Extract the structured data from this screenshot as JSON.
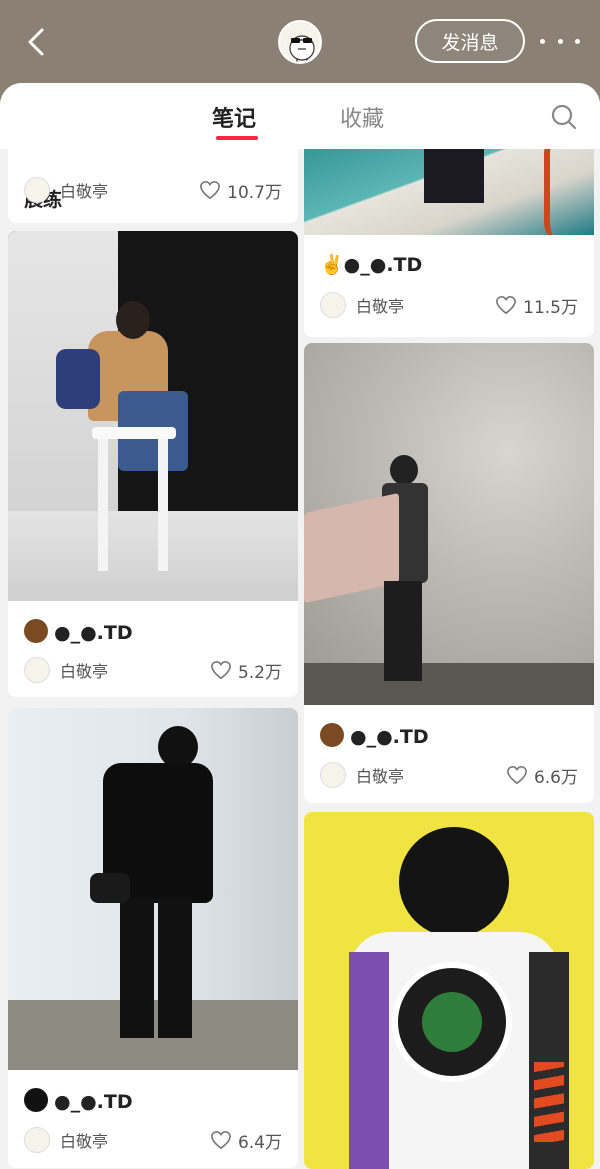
{
  "header": {
    "message_button": "发消息"
  },
  "tabs": {
    "notes": "笔记",
    "collections": "收藏"
  },
  "colors": {
    "header_bg": "#8a8074",
    "accent": "#ff2442"
  },
  "cards": [
    {
      "title": "晨练",
      "author": "白敬亭",
      "likes": "10.7万"
    },
    {
      "title": "✌️●_●.TD",
      "author": "白敬亭",
      "likes": "11.5万"
    },
    {
      "title": "●_●.TD",
      "emoji": "brown-circle",
      "author": "白敬亭",
      "likes": "5.2万"
    },
    {
      "title": "●_●.TD",
      "emoji": "brown-circle",
      "author": "白敬亭",
      "likes": "6.6万"
    },
    {
      "title": "●_●.TD",
      "emoji": "black-circle",
      "author": "白敬亭",
      "likes": "6.4万"
    },
    {
      "title": "",
      "author": "",
      "likes": ""
    }
  ],
  "icons": [
    "back-arrow-icon",
    "more-dots-icon",
    "search-icon",
    "heart-icon",
    "avatar-duck"
  ]
}
